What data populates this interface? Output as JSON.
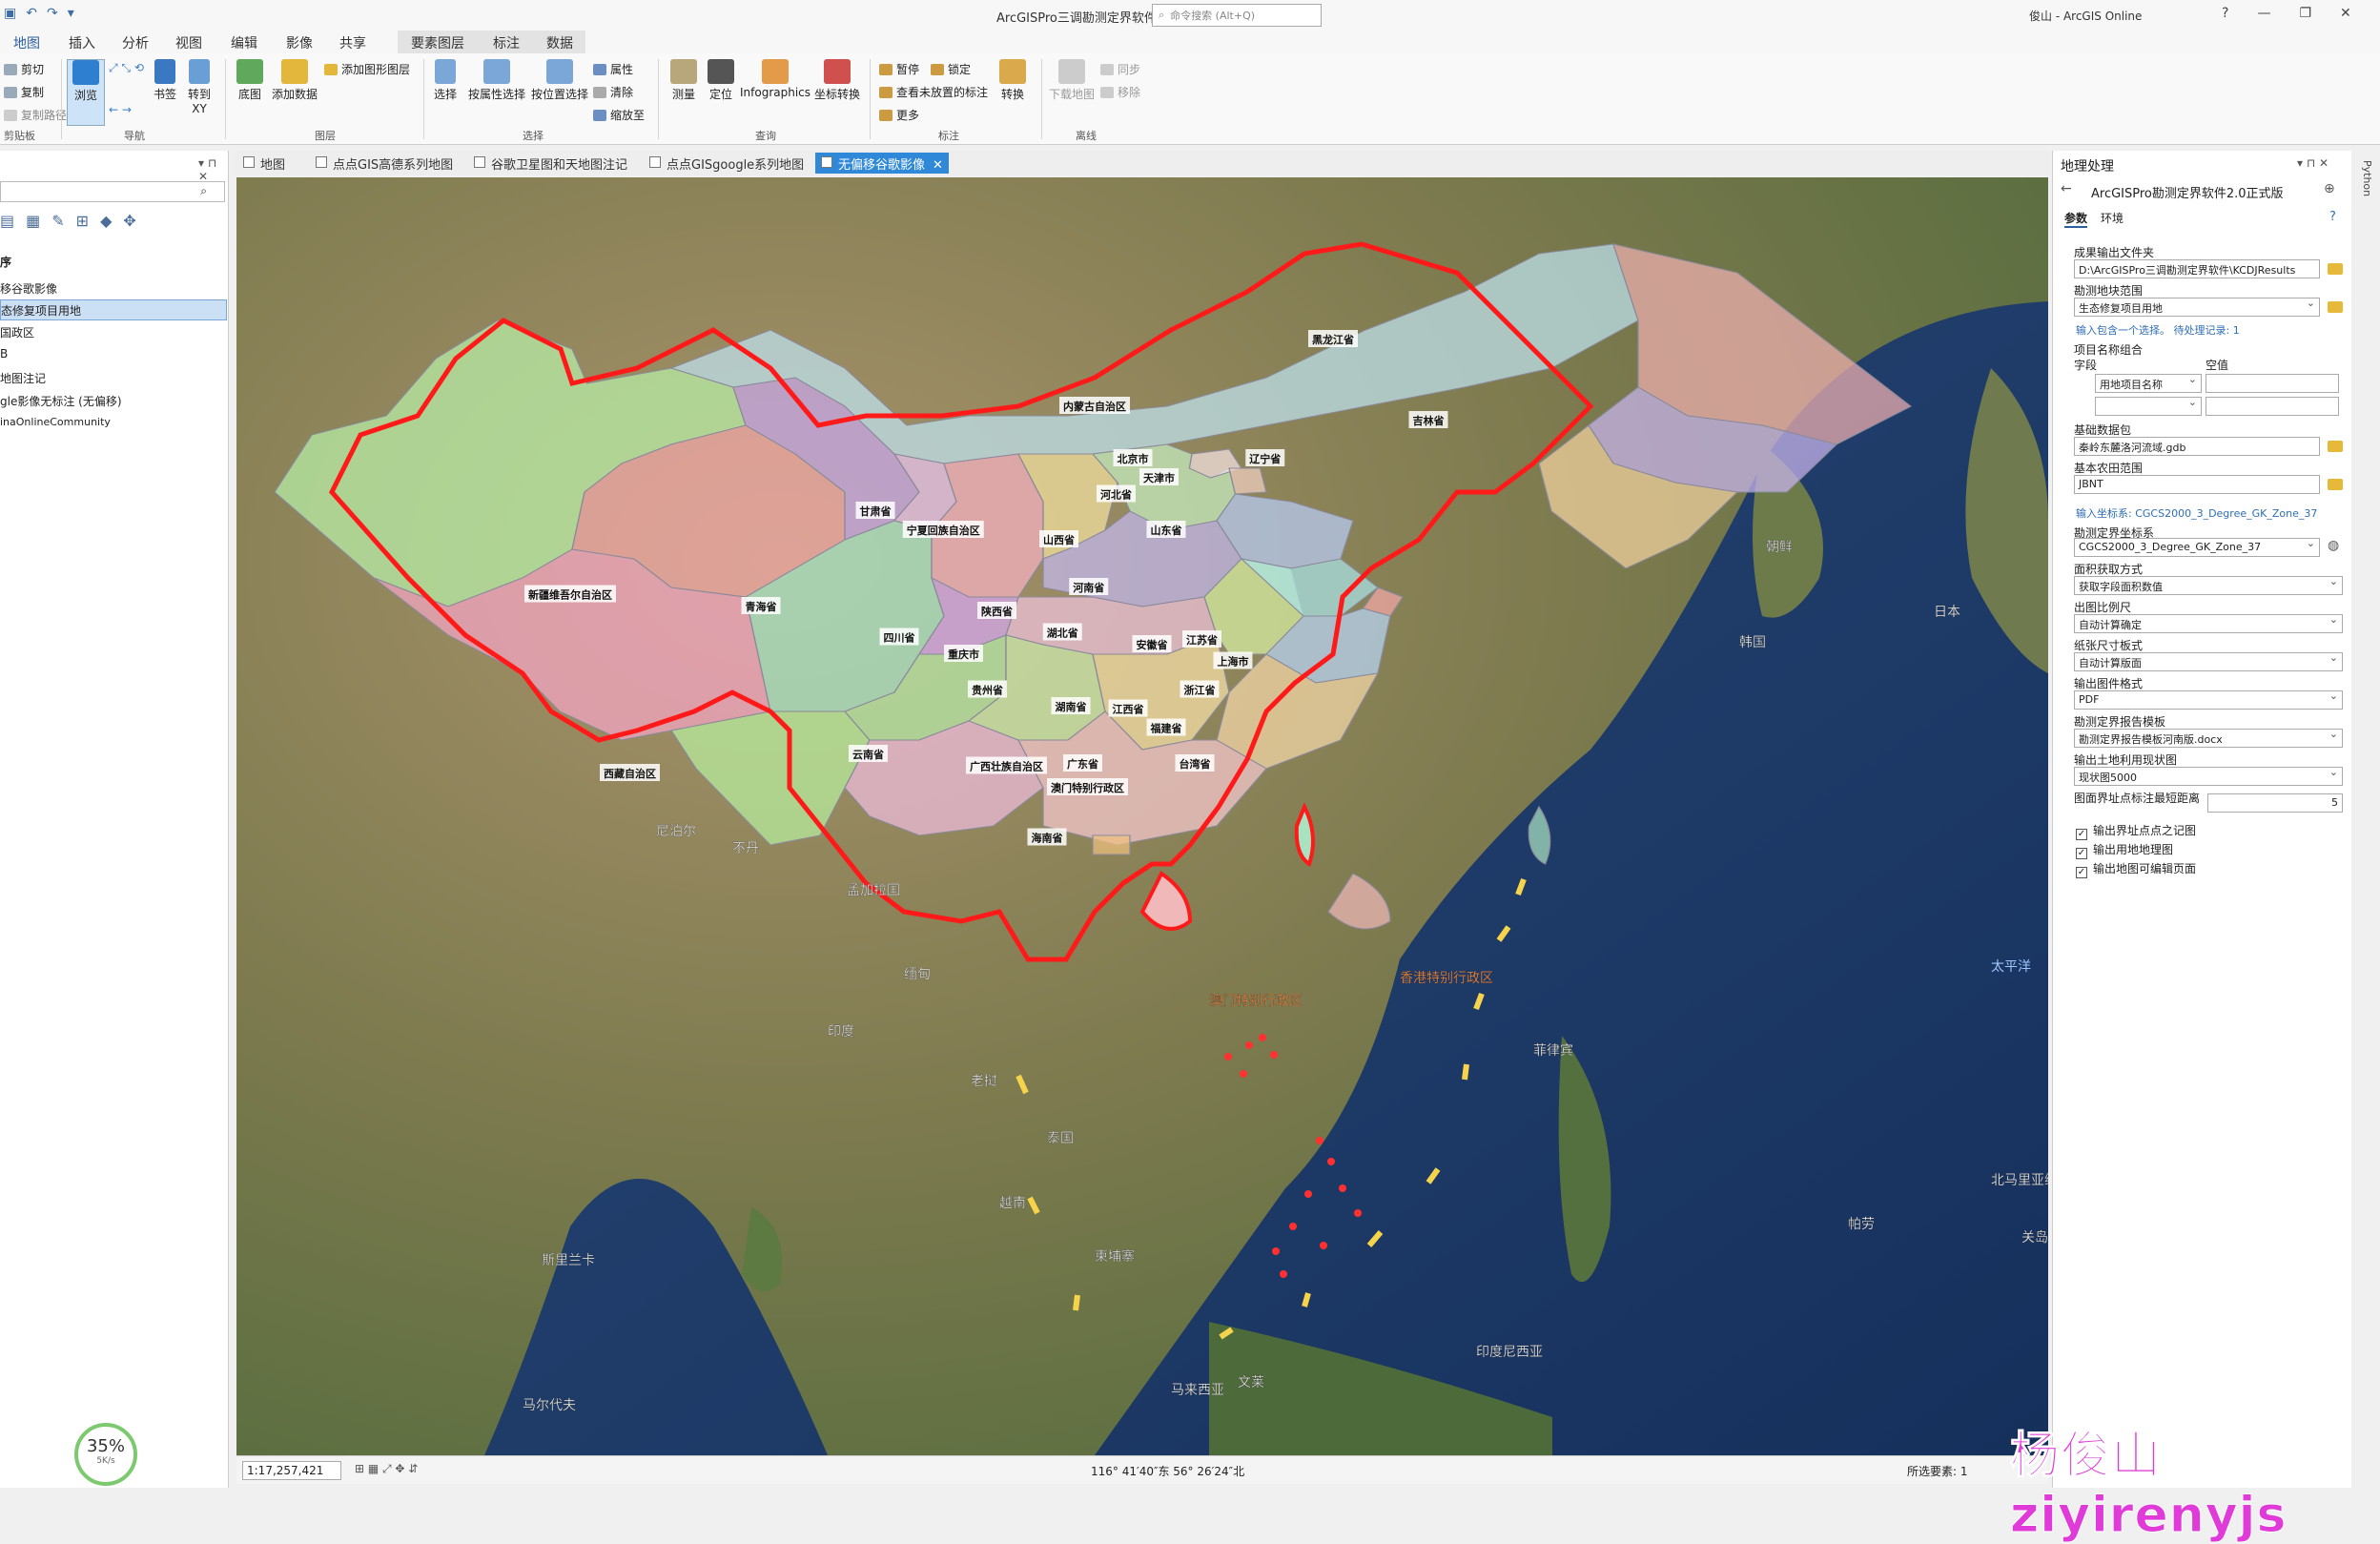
{
  "titlebar": {
    "app_title": "ArcGISPro三调勘测定界软件",
    "search_placeholder": "命令搜索 (Alt+Q)",
    "user": "俊山 - ArcGIS Online",
    "controls": [
      "?",
      "—",
      "❐",
      "✕"
    ]
  },
  "ribbon_tabs": [
    "地图",
    "插入",
    "分析",
    "视图",
    "编辑",
    "影像",
    "共享",
    "要素图层",
    "标注",
    "数据"
  ],
  "ribbon": {
    "clipboard": {
      "cut": "剪切",
      "copy": "复制",
      "copy_path": "复制路径",
      "label": "剪贴板"
    },
    "navigate": {
      "explore": "浏览",
      "bookmarks": "书签",
      "goto": "转到XY",
      "label": "导航"
    },
    "layer": {
      "basemap": "底图",
      "add_data": "添加数据",
      "add_graphics": "添加图形图层",
      "label": "图层"
    },
    "selection": {
      "select": "选择",
      "by_attr": "按属性选择",
      "by_loc": "按位置选择",
      "attributes": "属性",
      "clear": "清除",
      "zoom_to": "缩放至",
      "label": "选择"
    },
    "inquiry": {
      "measure": "测量",
      "locate": "定位",
      "infographics": "Infographics",
      "coord_convert": "坐标转换",
      "label": "查询"
    },
    "labeling": {
      "pause": "暂停",
      "lock": "锁定",
      "unplaced": "查看未放置的标注",
      "more": "更多",
      "convert": "转换",
      "label": "标注"
    },
    "offline": {
      "download": "下载地图",
      "sync": "同步",
      "remove": "移除",
      "label": "离线"
    }
  },
  "contents": {
    "section": "序",
    "layers": [
      "移谷歌影像",
      "态修复项目用地",
      "国政区",
      "B",
      "地图注记",
      "gle影像无标注 (无偏移)",
      "inaOnlineCommunity"
    ],
    "selected_index": 1
  },
  "view_tabs": [
    "地图",
    "点点GIS高德系列地图",
    "谷歌卫星图和天地图注记",
    "点点GISgoogle系列地图",
    "无偏移谷歌影像"
  ],
  "active_view_tab": 4,
  "map": {
    "provinces": [
      {
        "name": "新疆维吾尔自治区",
        "color": "#b9f0a8"
      },
      {
        "name": "西藏自治区",
        "color": "#f5a6c4"
      },
      {
        "name": "青海省",
        "color": "#f2a7a7"
      },
      {
        "name": "甘肃省",
        "color": "#c8a8ea"
      },
      {
        "name": "内蒙古自治区",
        "color": "#bfe3ef"
      },
      {
        "name": "黑龙江省",
        "color": "#f0b0b0"
      },
      {
        "name": "吉林省",
        "color": "#c9b6ef"
      },
      {
        "name": "辽宁省",
        "color": "#f3d2a0"
      },
      {
        "name": "四川省",
        "color": "#a9e7c9"
      },
      {
        "name": "云南省",
        "color": "#b9ef9e"
      },
      {
        "name": "宁夏回族自治区",
        "color": "#e7c3f0"
      },
      {
        "name": "陕西省",
        "color": "#f5b1c1"
      },
      {
        "name": "山西省",
        "color": "#f3e2a0"
      },
      {
        "name": "河北省",
        "color": "#c6efc0"
      },
      {
        "name": "北京市",
        "color": "#f5e2e2"
      },
      {
        "name": "天津市",
        "color": "#f2d0c0"
      },
      {
        "name": "山东省",
        "color": "#b8cdf5"
      },
      {
        "name": "河南省",
        "color": "#c4b8ef"
      },
      {
        "name": "湖北省",
        "color": "#f0c4dd"
      },
      {
        "name": "重庆市",
        "color": "#d6a8ef"
      },
      {
        "name": "贵州省",
        "color": "#b7eaa8"
      },
      {
        "name": "湖南省",
        "color": "#d0efb0"
      },
      {
        "name": "江西省",
        "color": "#f6e1a8"
      },
      {
        "name": "安徽省",
        "color": "#d8f0a4"
      },
      {
        "name": "江苏省",
        "color": "#a9e3e6"
      },
      {
        "name": "上海市",
        "color": "#f4a8a8"
      },
      {
        "name": "浙江省",
        "color": "#b8d5f5"
      },
      {
        "name": "福建省",
        "color": "#f5d8a8"
      },
      {
        "name": "广西壮族自治区",
        "color": "#f0bede"
      },
      {
        "name": "广东省",
        "color": "#f7c9cf"
      },
      {
        "name": "台湾省",
        "color": "#a8e2c0"
      },
      {
        "name": "海南省",
        "color": "#f0b8b8"
      },
      {
        "name": "澳门特别行政区",
        "color": "#f0c080"
      }
    ],
    "labels_world": [
      "尼泊尔",
      "不丹",
      "孟加拉国",
      "缅甸",
      "印度",
      "老挝",
      "泰国",
      "越南",
      "柬埔寨",
      "马来西亚",
      "文莱",
      "菲律宾",
      "日本",
      "韩国",
      "朝鲜",
      "斯里兰卡",
      "马尔代夫",
      "帕劳",
      "北马里亚纳",
      "关岛(美)",
      "香港特别行政区",
      "澳门特别行政区",
      "印度尼西亚"
    ],
    "ocean_labels": [
      "太平洋"
    ]
  },
  "status": {
    "scale": "1:17,257,421",
    "coords": "116° 41′40″东 56° 26′24″北",
    "selected": "所选要素: 1"
  },
  "geoprocessing": {
    "panel_title": "地理处理",
    "tool_title": "ArcGISPro勘测定界软件2.0正式版",
    "tabs": [
      "参数",
      "环境"
    ],
    "params": [
      {
        "label": "成果输出文件夹",
        "value": "D:\\ArcGISPro三调勘测定界软件\\KCDJResults",
        "folder": true
      },
      {
        "label": "勘测地块范围",
        "value": "生态修复项目用地",
        "dropdown": true,
        "folder": true
      }
    ],
    "info1": "输入包含一个选择。 待处理记录: 1",
    "combo_label": "项目名称组合",
    "field_header": "字段",
    "empty_header": "空值",
    "field_value": "用地项目名称",
    "base_db_label": "基础数据包",
    "base_db_value": "秦岭东麓洛河流域.gdb",
    "farm_label": "基本农田范围",
    "farm_value": "JBNT",
    "info2": "输入坐标系: CGCS2000_3_Degree_GK_Zone_37",
    "survey_crs_label": "勘测定界坐标系",
    "survey_crs_value": "CGCS2000_3_Degree_GK_Zone_37",
    "area_label": "面积获取方式",
    "area_value": "获取字段面积数值",
    "scale_label": "出图比例尺",
    "scale_value": "自动计算确定",
    "paper_label": "纸张尺寸板式",
    "paper_value": "自动计算版面",
    "format_label": "输出图件格式",
    "format_value": "PDF",
    "template_label": "勘测定界报告模板",
    "template_value": "勘测定界报告模板河南版.docx",
    "landuse_label": "输出土地利用现状图",
    "landuse_value": "现状图5000",
    "min_dist_label": "图面界址点标注最短距离",
    "min_dist_value": "5",
    "checks": [
      "输出界址点点之记图",
      "输出用地地理图",
      "输出地图可编辑页面"
    ]
  },
  "netmeter": {
    "percent": "35%",
    "speed": "5K/s"
  },
  "watermark": "杨俊山ziyirenyjs",
  "python_tab": "Python"
}
